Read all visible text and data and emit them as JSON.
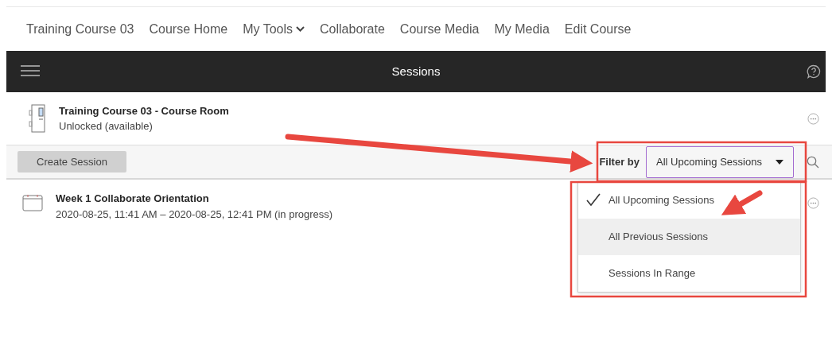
{
  "course_nav": {
    "items": [
      {
        "label": "Training Course 03",
        "kind": "link"
      },
      {
        "label": "Course Home",
        "kind": "link"
      },
      {
        "label": "My Tools",
        "kind": "menu"
      },
      {
        "label": "Collaborate",
        "kind": "link"
      },
      {
        "label": "Course Media",
        "kind": "link"
      },
      {
        "label": "My Media",
        "kind": "link"
      },
      {
        "label": "Edit Course",
        "kind": "link"
      }
    ]
  },
  "header": {
    "title": "Sessions"
  },
  "course_room": {
    "title": "Training Course 03 - Course Room",
    "status": "Unlocked (available)"
  },
  "toolbar": {
    "create_button": "Create Session",
    "filter_label": "Filter by",
    "filter_value": "All Upcoming Sessions"
  },
  "sessions": [
    {
      "title": "Week 1 Collaborate Orientation",
      "time": "2020-08-25, 11:41 AM – 2020-08-25, 12:41 PM (in progress)"
    }
  ],
  "filter_menu": {
    "options": [
      {
        "label": "All Upcoming Sessions",
        "selected": true,
        "hovered": false
      },
      {
        "label": "All Previous Sessions",
        "selected": false,
        "hovered": true
      },
      {
        "label": "Sessions In Range",
        "selected": false,
        "hovered": false
      }
    ]
  }
}
